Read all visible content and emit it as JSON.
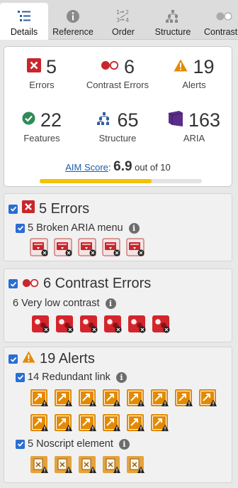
{
  "tabs": [
    {
      "label": "Details",
      "icon": "list-icon",
      "active": true
    },
    {
      "label": "Reference",
      "icon": "info-icon",
      "active": false
    },
    {
      "label": "Order",
      "icon": "order-icon",
      "active": false
    },
    {
      "label": "Structure",
      "icon": "structure-icon",
      "active": false
    },
    {
      "label": "Contrast",
      "icon": "contrast-icon",
      "active": false
    }
  ],
  "summary": {
    "errors": {
      "count": "5",
      "label": "Errors"
    },
    "contrast": {
      "count": "6",
      "label": "Contrast Errors"
    },
    "alerts": {
      "count": "19",
      "label": "Alerts"
    },
    "features": {
      "count": "22",
      "label": "Features"
    },
    "structure": {
      "count": "65",
      "label": "Structure"
    },
    "aria": {
      "count": "163",
      "label": "ARIA"
    },
    "score_link": "AIM Score",
    "score_sep": ": ",
    "score_value": "6.9",
    "score_suffix": " out of 10",
    "score_fraction": 0.69
  },
  "panels": {
    "errors": {
      "title": "5 Errors",
      "items": [
        {
          "label": "5 Broken ARIA menu",
          "count": 5
        }
      ]
    },
    "contrast": {
      "title": "6 Contrast Errors",
      "items": [
        {
          "label": "6 Very low contrast",
          "count": 6
        }
      ]
    },
    "alerts": {
      "title": "19 Alerts",
      "items": [
        {
          "label": "14 Redundant link",
          "count": 14
        },
        {
          "label": "5 Noscript element",
          "count": 5
        }
      ]
    }
  },
  "colors": {
    "error": "#c8262c",
    "alert": "#e38a00",
    "feature": "#2e8b57",
    "structure": "#2f5f9e",
    "aria": "#5b2d8a",
    "checkbox": "#2a6dd4",
    "score_bar": "#f2c300"
  }
}
